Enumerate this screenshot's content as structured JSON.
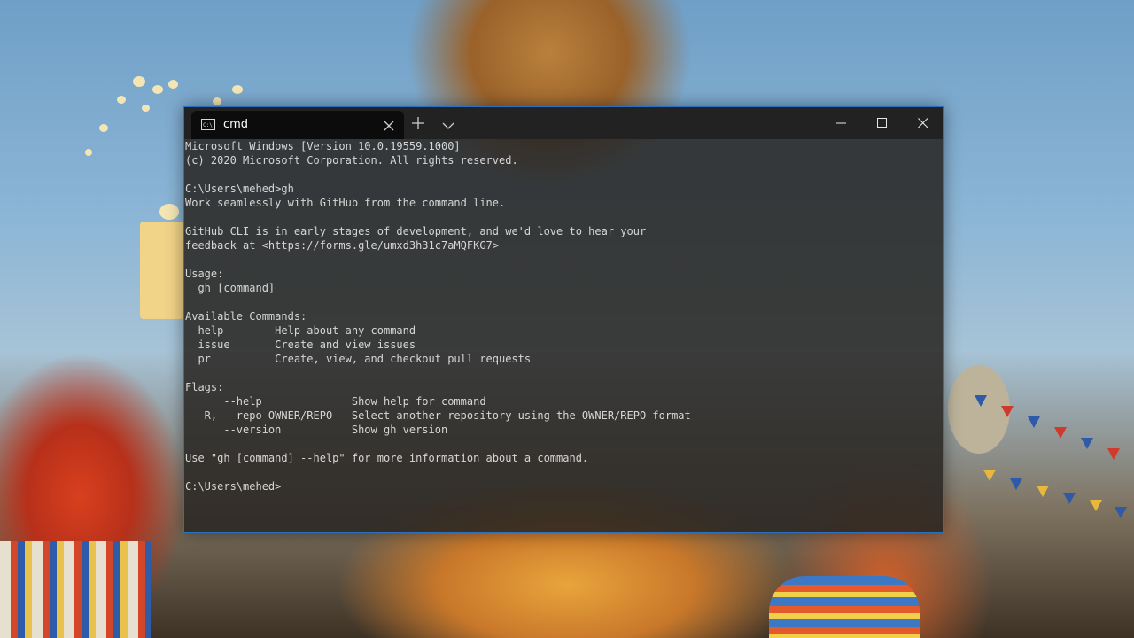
{
  "window": {
    "tab_title": "cmd",
    "tab_icon": "cmd-prompt-icon",
    "new_tab_icon": "plus-icon",
    "dropdown_icon": "chevron-down-icon",
    "minimize_icon": "minimize-icon",
    "maximize_icon": "maximize-icon",
    "close_icon": "close-icon"
  },
  "console": {
    "lines": [
      "Microsoft Windows [Version 10.0.19559.1000]",
      "(c) 2020 Microsoft Corporation. All rights reserved.",
      "",
      "C:\\Users\\mehed>gh",
      "Work seamlessly with GitHub from the command line.",
      "",
      "GitHub CLI is in early stages of development, and we'd love to hear your",
      "feedback at <https://forms.gle/umxd3h31c7aMQFKG7>",
      "",
      "Usage:",
      "  gh [command]",
      "",
      "Available Commands:",
      "  help        Help about any command",
      "  issue       Create and view issues",
      "  pr          Create, view, and checkout pull requests",
      "",
      "Flags:",
      "      --help              Show help for command",
      "  -R, --repo OWNER/REPO   Select another repository using the OWNER/REPO format",
      "      --version           Show gh version",
      "",
      "Use \"gh [command] --help\" for more information about a command.",
      "",
      "C:\\Users\\mehed>"
    ]
  },
  "colors": {
    "window_border": "#2b6fc2",
    "titlebar": "#222222",
    "active_tab": "#0c0c0c",
    "console_text": "#d6d6d6"
  }
}
